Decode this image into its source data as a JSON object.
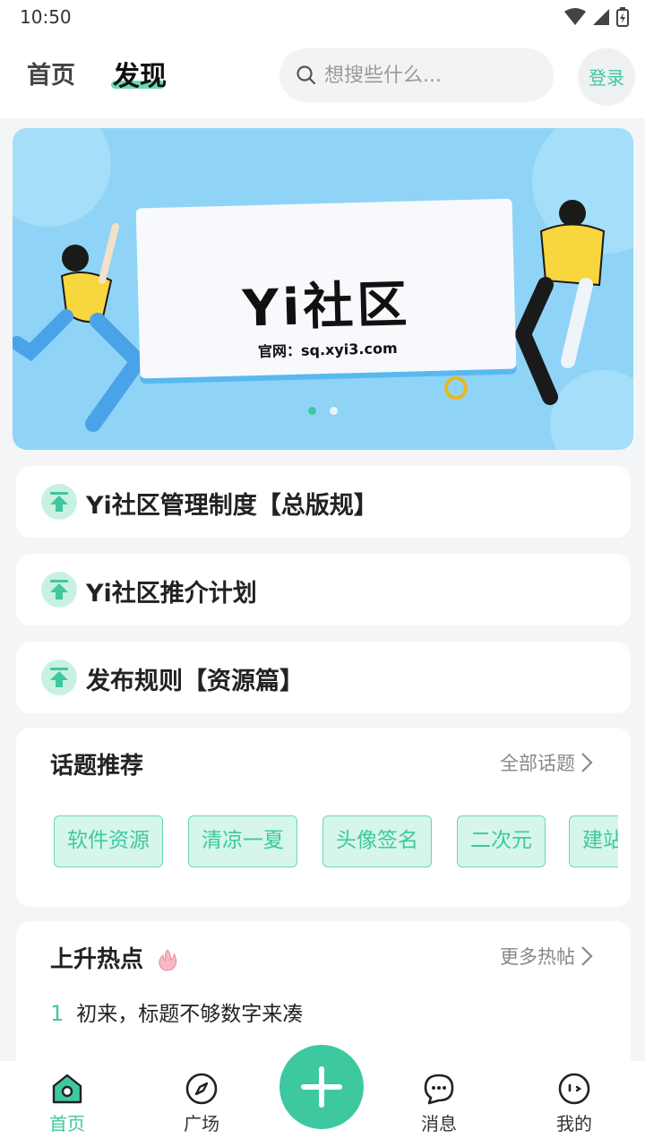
{
  "status_bar": {
    "time": "10:50"
  },
  "header": {
    "tabs": [
      {
        "label": "首页"
      },
      {
        "label": "发现"
      }
    ],
    "search": {
      "placeholder": "想搜些什么..."
    },
    "login_label": "登录"
  },
  "banner": {
    "title": "Yi社区",
    "site": "官网：sq.xyi3.com",
    "pages": 2,
    "current_page": 1
  },
  "rules": [
    {
      "text": "Yi社区管理制度【总版规】"
    },
    {
      "text": "Yi社区推介计划"
    },
    {
      "text": "发布规则【资源篇】"
    }
  ],
  "topics": {
    "title": "话题推荐",
    "more_label": "全部话题",
    "chips": [
      "软件资源",
      "清凉一夏",
      "头像签名",
      "二次元",
      "建站"
    ]
  },
  "hot": {
    "title": "上升热点",
    "more_label": "更多热帖",
    "items": [
      {
        "rank": "1",
        "text": "初来，标题不够数字来凑"
      }
    ]
  },
  "bottom_nav": {
    "items": [
      {
        "label": "首页",
        "icon": "home-icon",
        "active": true
      },
      {
        "label": "广场",
        "icon": "compass-icon"
      },
      {
        "label": "消息",
        "icon": "chat-icon"
      },
      {
        "label": "我的",
        "icon": "profile-face-icon"
      }
    ],
    "fab_icon": "plus-icon"
  },
  "colors": {
    "accent": "#3ec8a0",
    "background": "#f4f5f7"
  }
}
